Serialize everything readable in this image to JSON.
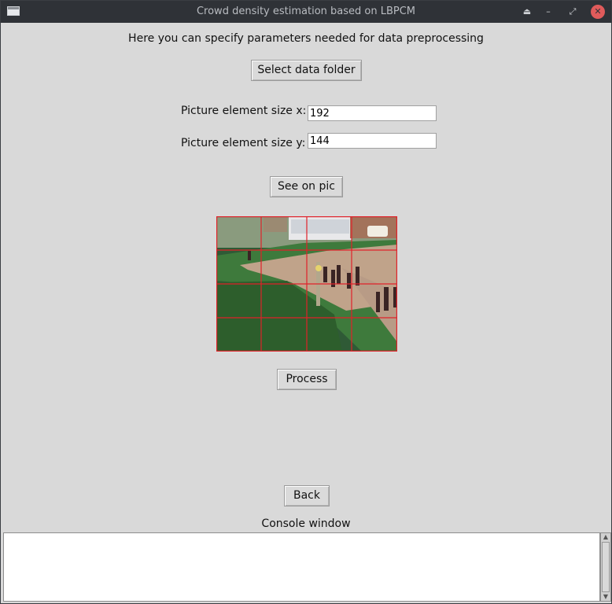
{
  "window": {
    "title": "Crowd density estimation based on LBPCM",
    "controls": {
      "eject": "⏏",
      "minimize": "–",
      "maximize": "⤢",
      "close": "✕"
    }
  },
  "header_text": "Here you can specify parameters needed for data preprocessing",
  "select_button_label": "Select data folder",
  "size_x": {
    "label": "Picture element size x:",
    "value": "192"
  },
  "size_y": {
    "label": "Picture element size y:",
    "value": "144"
  },
  "see_button_label": "See on pic",
  "preview": {
    "grid_color": "#e0222a",
    "description_icon": "image-preview"
  },
  "process_button_label": "Process",
  "back_button_label": "Back",
  "console_label": "Console window",
  "console_text": ""
}
